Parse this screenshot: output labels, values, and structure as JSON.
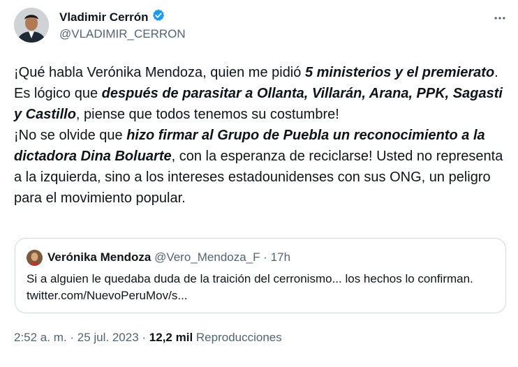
{
  "author": {
    "name": "Vladimir Cerrón",
    "handle": "@VLADIMIR_CERRON",
    "verified_color": "#1d9bf0"
  },
  "tweet": {
    "p1": [
      {
        "t": "¡Qué habla Verónika Mendoza, quien me pidió ",
        "b": false
      },
      {
        "t": "5 ministerios y el premierato",
        "b": true
      },
      {
        "t": ". Es lógico que ",
        "b": false
      },
      {
        "t": "después de parasitar a Ollanta, Villarán, Arana, PPK, Sagasti y Castillo",
        "b": true
      },
      {
        "t": ", piense que todos tenemos su costumbre!",
        "b": false
      }
    ],
    "p2": [
      {
        "t": "¡No se olvide que ",
        "b": false
      },
      {
        "t": "hizo firmar al Grupo de Puebla un reconocimiento a la dictadora Dina Boluarte",
        "b": true
      },
      {
        "t": ", con la esperanza de reciclarse! Usted no representa a la izquierda, sino a los intereses estadounidenses con sus ONG, un peligro para el movimiento popular.",
        "b": false
      }
    ]
  },
  "quote": {
    "name": "Verónika Mendoza",
    "handle": "@Vero_Mendoza_F",
    "separator": "·",
    "time": "17h",
    "text": "Si a alguien le quedaba duda de la traición del cerronismo... los hechos lo confirman. twitter.com/NuevoPeruMov/s..."
  },
  "footer": {
    "time": "2:52 a. m.",
    "separator": "·",
    "date": "25 jul. 2023",
    "views": "12,2 mil",
    "views_label": "Reproducciones"
  }
}
